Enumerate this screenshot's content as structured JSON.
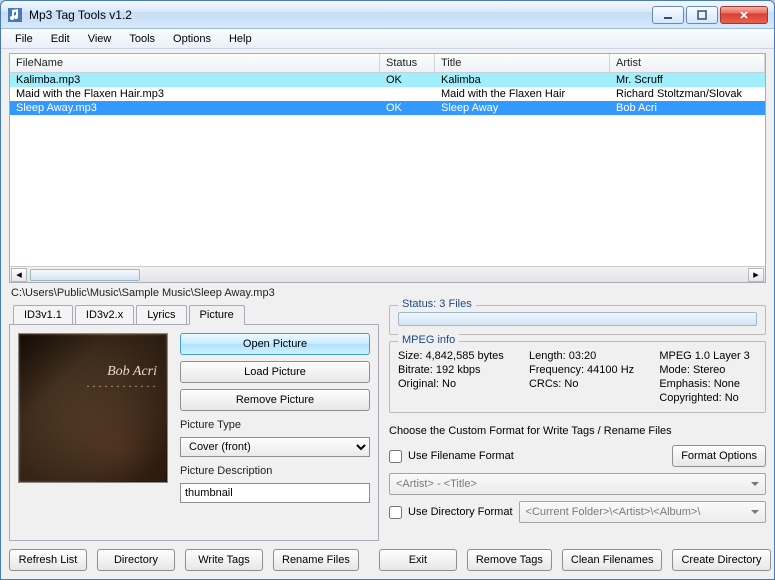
{
  "window": {
    "title": "Mp3 Tag Tools v1.2"
  },
  "menu": {
    "file": "File",
    "edit": "Edit",
    "view": "View",
    "tools": "Tools",
    "options": "Options",
    "help": "Help"
  },
  "columns": {
    "filename": "FileName",
    "status": "Status",
    "title": "Title",
    "artist": "Artist"
  },
  "rows": [
    {
      "filename": "Kalimba.mp3",
      "status": "OK",
      "title": "Kalimba",
      "artist": "Mr. Scruff",
      "state": "highlight"
    },
    {
      "filename": "Maid with the Flaxen Hair.mp3",
      "status": "",
      "title": "Maid with the Flaxen Hair",
      "artist": "Richard Stoltzman/Slovak",
      "state": ""
    },
    {
      "filename": "Sleep Away.mp3",
      "status": "OK",
      "title": "Sleep Away",
      "artist": "Bob Acri",
      "state": "selected"
    }
  ],
  "path": "C:\\Users\\Public\\Music\\Sample Music\\Sleep Away.mp3",
  "tabs": {
    "id3v11": "ID3v1.1",
    "id3v2x": "ID3v2.x",
    "lyrics": "Lyrics",
    "picture": "Picture"
  },
  "albumart": {
    "artist": "Bob Acri"
  },
  "picbuttons": {
    "open": "Open Picture",
    "load": "Load Picture",
    "remove": "Remove Picture"
  },
  "piclabels": {
    "type": "Picture Type",
    "desc": "Picture Description"
  },
  "picvalues": {
    "type": "Cover (front)",
    "desc": "thumbnail"
  },
  "status": {
    "label": "Status: 3 Files"
  },
  "mpeg": {
    "legend": "MPEG info",
    "size": "Size: 4,842,585 bytes",
    "length": "Length:  03:20",
    "layer": "MPEG 1.0 Layer 3",
    "bitrate": "Bitrate: 192 kbps",
    "freq": "Frequency: 44100 Hz",
    "mode": "Mode: Stereo",
    "original": "Original: No",
    "crcs": "CRCs: No",
    "emphasis": "Emphasis: None",
    "copyright": "Copyrighted: No"
  },
  "custom": {
    "choose": "Choose the Custom Format for Write Tags / Rename Files",
    "useFilename": "Use Filename Format",
    "formatOptions": "Format Options",
    "filenameCombo": "<Artist> - <Title>",
    "useDirectory": "Use Directory Format",
    "directoryCombo": "<Current Folder>\\<Artist>\\<Album>\\"
  },
  "bottom": {
    "refresh": "Refresh List",
    "directory": "Directory",
    "writeTags": "Write Tags",
    "renameFiles": "Rename Files",
    "exit": "Exit",
    "removeTags": "Remove Tags",
    "cleanFilenames": "Clean Filenames",
    "createDirectory": "Create Directory"
  }
}
